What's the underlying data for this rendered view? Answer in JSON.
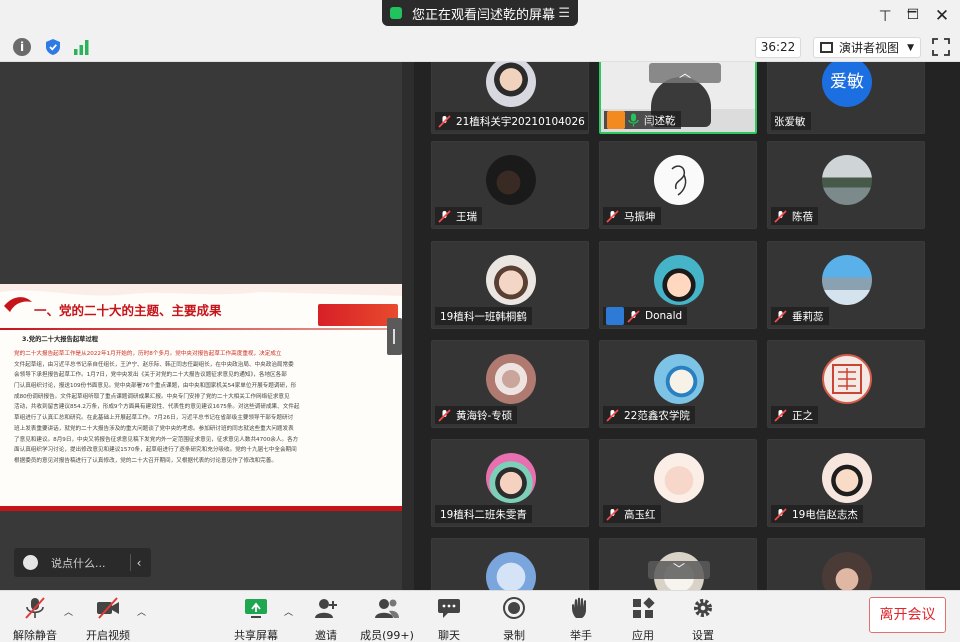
{
  "titlebar": {
    "banner_text": "您正在观看闫述乾的屏幕"
  },
  "topbar": {
    "timer": "36:22",
    "view_label": "演讲者视图"
  },
  "slide": {
    "title": "一、党的二十大的主题、主要成果",
    "subtitle": "3.党的二十大报告起草过程",
    "lines": [
      "党的二十大报告起草工作是从2022年1月开始的，历时8个多月。党中央对报告起草工作高度重视，决定成立",
      "文件起草组，由习近平总书记亲自任组长，王沪宁、赵乐际、韩正同志任副组长，在中央政治局、中央政治局常委",
      "会领导下承担报告起草工作。1月7日，党中央发出《关于对党的二十大报告议题征求意见的通知》，各地区各部",
      "门认真组织讨论，报送109份书面意见。党中央部署76个重点课题，由中央和国家机关54家单位开展专题调研，形",
      "成80份调研报告。文件起草组听取了重点课题调研成果汇报。中央专门安排了党的二十大相关工作网络征求意见",
      "活动，共收到留言建议854.2万条，形成9个方面具有建设性、代表性的意见建议1675条。对这些调研成果、文件起",
      "草组进行了认真汇总和研究。在此基础上开展起草工作。7月26日，习近平总书记在省部级主要领导干部专题研讨",
      "班上发表重要讲话，就党的二十大报告涉及的重大问题谈了党中央的考虑。参加研讨班的同志就这些重大问题发表",
      "了意见和建议。8月9日，中央又将报告征求意见稿下发党内外一定范围征求意见，征求意见人数共4700余人。各方",
      "面认真组织学习讨论，提出修改意见和建议1570条，起草组进行了逐条研究和充分吸收。党的十九届七中全会期间",
      "根据委员的意见对报告稿进行了认真修改，党的二十大召开期间，又根据代表的讨论意见作了修改和完善。"
    ]
  },
  "chat": {
    "placeholder": "说点什么..."
  },
  "participants": [
    {
      "name": "21植科关宇20210104026",
      "avatar": "photo-face"
    },
    {
      "name": "闫述乾",
      "avatar": "video"
    },
    {
      "name": "张爱敏",
      "avatar_text": "爱敏"
    },
    {
      "name": "王瑞",
      "avatar": "photo-dark"
    },
    {
      "name": "马振坤",
      "avatar": "sketch"
    },
    {
      "name": "陈蓓",
      "avatar": "photo-lake"
    },
    {
      "name": "19植科一班韩桐鹤",
      "avatar": "photo-child"
    },
    {
      "name": "Donald",
      "avatar": "cartoon-girl"
    },
    {
      "name": "垂莉蕊",
      "avatar": "photo-city"
    },
    {
      "name": "黄海铃-专硕",
      "avatar": "photo-flower"
    },
    {
      "name": "22范鑫农学院",
      "avatar": "cartoon-runner"
    },
    {
      "name": "正之",
      "avatar": "seal"
    },
    {
      "name": "19植科二班朱雯青",
      "avatar": "photo-rainbow"
    },
    {
      "name": "高玉红",
      "avatar": "cartoon-bear"
    },
    {
      "name": "19电信赵志杰",
      "avatar": "cartoon-kid"
    }
  ],
  "toolbar": {
    "unmute": "解除静音",
    "start_video": "开启视频",
    "share_screen": "共享屏幕",
    "invite": "邀请",
    "members": "成员(99+)",
    "chat": "聊天",
    "record": "录制",
    "raise_hand": "举手",
    "apps": "应用",
    "settings": "设置",
    "leave": "离开会议"
  },
  "colors": {
    "accent_red": "#c6141b",
    "share_green": "#22c35e",
    "leave_red": "#e0262b"
  }
}
